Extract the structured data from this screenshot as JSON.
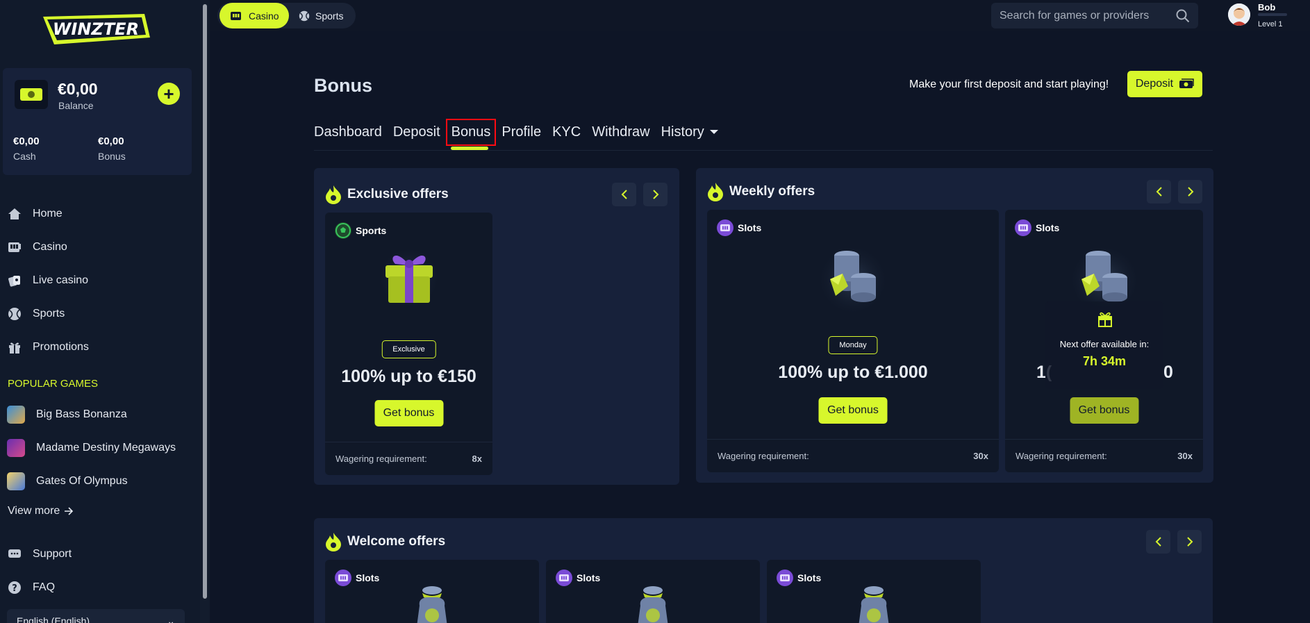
{
  "brand": {
    "logo_text": "WINZTER",
    "accent": "#d7f72c",
    "bg": "#0f1626"
  },
  "balance": {
    "amount": "€0,00",
    "label": "Balance",
    "cash_value": "€0,00",
    "cash_label": "Cash",
    "bonus_value": "€0,00",
    "bonus_label": "Bonus"
  },
  "sidebar": {
    "nav": [
      {
        "label": "Home",
        "icon": "home-icon"
      },
      {
        "label": "Casino",
        "icon": "slot-machine-icon"
      },
      {
        "label": "Live casino",
        "icon": "cards-icon"
      },
      {
        "label": "Sports",
        "icon": "tennis-ball-icon"
      },
      {
        "label": "Promotions",
        "icon": "gift-icon"
      }
    ],
    "popular_title": "POPULAR GAMES",
    "popular": [
      {
        "label": "Big Bass Bonanza"
      },
      {
        "label": "Madame Destiny Megaways"
      },
      {
        "label": "Gates Of Olympus"
      }
    ],
    "view_more": "View more",
    "support": [
      {
        "label": "Support",
        "icon": "chat-icon"
      },
      {
        "label": "FAQ",
        "icon": "question-icon"
      }
    ],
    "language": "English (English)"
  },
  "topbar": {
    "casino_label": "Casino",
    "sports_label": "Sports",
    "search_placeholder": "Search for games or providers",
    "user_name": "Bob",
    "user_level": "Level 1"
  },
  "page": {
    "title": "Bonus",
    "first_deposit_text": "Make your first deposit and start playing!",
    "deposit_label": "Deposit",
    "tabs": [
      {
        "label": "Dashboard"
      },
      {
        "label": "Deposit"
      },
      {
        "label": "Bonus",
        "active": true
      },
      {
        "label": "Profile"
      },
      {
        "label": "KYC"
      },
      {
        "label": "Withdraw"
      },
      {
        "label": "History"
      }
    ]
  },
  "exclusive": {
    "title": "Exclusive offers",
    "card": {
      "category": "Sports",
      "badge": "Exclusive",
      "amount": "100% up to €150",
      "button": "Get bonus",
      "wagering_label": "Wagering requirement:",
      "wagering_value": "8x"
    }
  },
  "weekly": {
    "title": "Weekly offers",
    "cards": [
      {
        "category": "Slots",
        "badge": "Monday",
        "amount": "100% up to €1.000",
        "button": "Get bonus",
        "wagering_label": "Wagering requirement:",
        "wagering_value": "30x"
      },
      {
        "category": "Slots",
        "amount_left": "1(",
        "amount_right": "0",
        "button": "Get bonus",
        "wagering_label": "Wagering requirement:",
        "wagering_value": "30x",
        "locked_text": "Next offer available in:",
        "locked_time": "7h 34m"
      }
    ]
  },
  "welcome": {
    "title": "Welcome offers",
    "cards": [
      {
        "category": "Slots"
      },
      {
        "category": "Slots"
      },
      {
        "category": "Slots"
      }
    ]
  }
}
